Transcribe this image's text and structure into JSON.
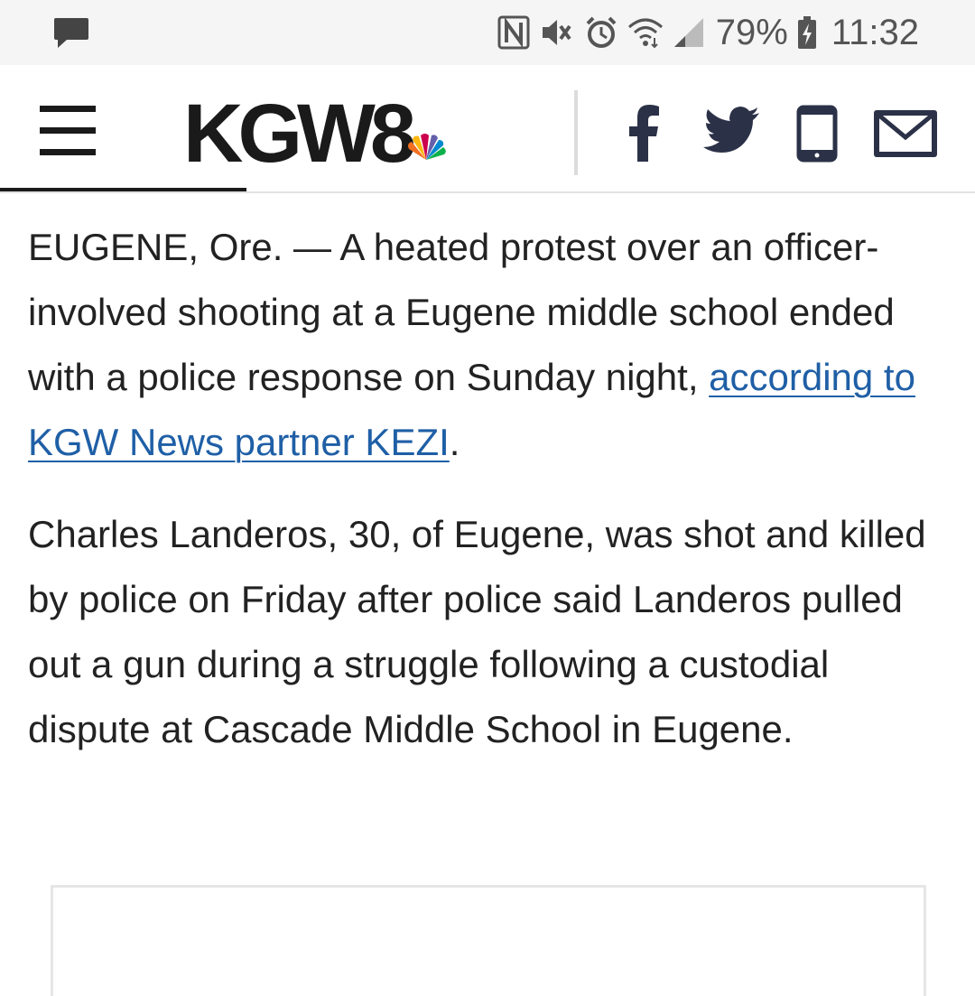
{
  "status_bar": {
    "battery": "79%",
    "time": "11:32",
    "icons": [
      "message-icon",
      "nfc-icon",
      "mute-icon",
      "alarm-icon",
      "wifi-icon",
      "signal-icon",
      "battery-charging-icon"
    ]
  },
  "header": {
    "logo_text": "KGW8",
    "logo_icon": "nbc-peacock-icon",
    "menu_icon": "hamburger-menu-icon",
    "share_icons": [
      "facebook-icon",
      "twitter-icon",
      "phone-icon",
      "mail-icon"
    ]
  },
  "article": {
    "p1_text": "EUGENE, Ore. — A heated protest over an officer-involved shooting at a Eugene middle school ended with a police response on Sunday night, ",
    "p1_link": "according to KGW News partner KEZI",
    "p1_end": ".",
    "p2_text": "Charles Landeros, 30, of Eugene, was shot and killed by police on Friday after police said Landeros pulled out a gun during a struggle following a custodial dispute at Cascade Middle School in Eugene."
  },
  "colors": {
    "link": "#1f5fa6",
    "text": "#222222",
    "status_bar_bg": "#f5f5f5",
    "icon_navy": "#2b3147"
  }
}
